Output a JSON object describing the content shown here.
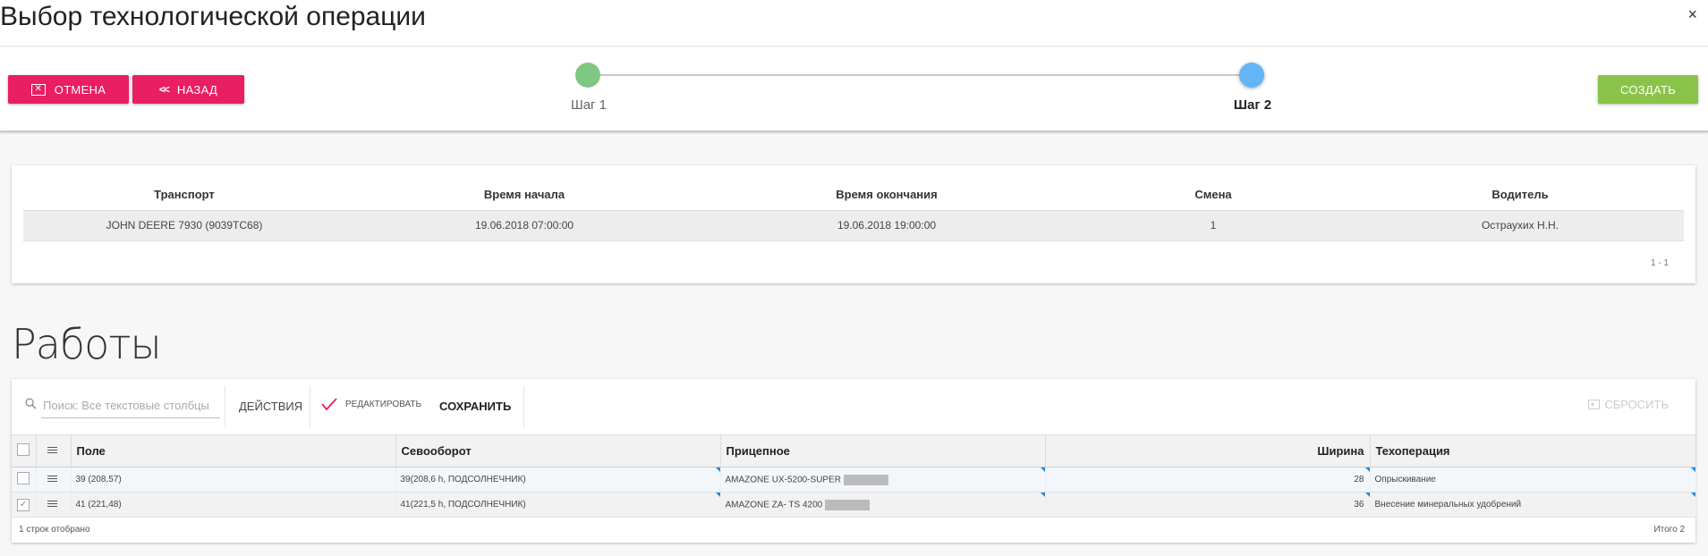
{
  "window": {
    "title": "Выбор технологической операции",
    "close": "×"
  },
  "buttons": {
    "cancel": "ОТМЕНА",
    "back": "НАЗАД",
    "create": "СОЗДАТЬ"
  },
  "stepper": {
    "steps": [
      {
        "label": "Шаг 1",
        "state": "done"
      },
      {
        "label": "Шаг 2",
        "state": "active"
      }
    ]
  },
  "summary": {
    "headers": [
      "Транспорт",
      "Время начала",
      "Время окончания",
      "Смена",
      "Водитель"
    ],
    "row": [
      "JOHN DEERE 7930 (9039TC68)",
      "19.06.2018 07:00:00",
      "19.06.2018 19:00:00",
      "1",
      "Остраухих Н.Н."
    ],
    "pager": "1 - 1"
  },
  "works": {
    "title": "Работы",
    "search_placeholder": "Поиск: Все текстовые столбцы",
    "actions": "ДЕЙСТВИЯ",
    "edit": "РЕДАКТИРОВАТЬ",
    "save": "СОХРАНИТЬ",
    "reset": "СБРОСИТЬ",
    "headers": [
      "Поле",
      "Севооборот",
      "Прицепное",
      "Ширина",
      "Техоперация"
    ],
    "rows": [
      {
        "field": "39 (208,57)",
        "rotation": "39(208,6 h, ПОДСОЛНЕЧНИК)",
        "trailer": "AMAZONE UX-5200-SUPER",
        "width": "28",
        "operation": "Опрыскивание",
        "checked": false
      },
      {
        "field": "41 (221,48)",
        "rotation": "41(221,5 h, ПОДСОЛНЕЧНИК)",
        "trailer": "AMAZONE ZA- TS 4200",
        "width": "36",
        "operation": "Внесение минеральных удобрений",
        "checked": true
      }
    ],
    "footer_left": "1 строк отобрано",
    "footer_right": "Итого 2"
  },
  "colors": {
    "primary": "#e91e63",
    "success": "#8bc34a",
    "step_done": "#81c784",
    "step_active": "#64b5f6"
  }
}
